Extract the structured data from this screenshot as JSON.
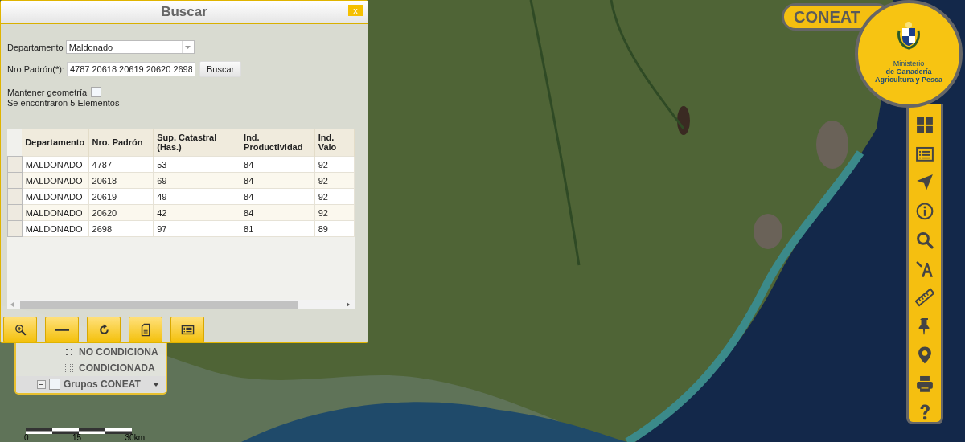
{
  "dialog": {
    "title": "Buscar",
    "close_label": "x",
    "departamento": {
      "label": "Departamento",
      "value": "Maldonado"
    },
    "padron": {
      "label": "Nro Padrón(*):",
      "value": "4787 20618 20619 20620 2698"
    },
    "search_button": "Buscar",
    "keep_geometry": {
      "label": "Mantener geometría",
      "checked": false
    },
    "result_text": "Se encontraron 5 Elementos",
    "table": {
      "columns": [
        "Departamento",
        "Nro. Padrón",
        "Sup. Catastral (Has.)",
        "Ind. Productividad",
        "Ind. Valo"
      ],
      "rows": [
        {
          "cells": [
            "MALDONADO",
            "4787",
            "53",
            "84",
            "92"
          ],
          "selected": false
        },
        {
          "cells": [
            "MALDONADO",
            "20618",
            "69",
            "84",
            "92"
          ],
          "selected": false
        },
        {
          "cells": [
            "MALDONADO",
            "20619",
            "49",
            "84",
            "92"
          ],
          "selected": false
        },
        {
          "cells": [
            "MALDONADO",
            "20620",
            "42",
            "84",
            "92"
          ],
          "selected": false
        },
        {
          "cells": [
            "MALDONADO",
            "2698",
            "97",
            "81",
            "89"
          ],
          "selected": false
        }
      ]
    }
  },
  "layer_panel": {
    "items": [
      {
        "kind": "legend",
        "label": "NO CONDICIONA"
      },
      {
        "kind": "legend",
        "label": "CONDICIONADA"
      },
      {
        "kind": "group",
        "label": "Grupos CONEAT",
        "checked": false,
        "expanded": true
      }
    ]
  },
  "scale": {
    "labels": [
      "0",
      "15",
      "30km"
    ]
  },
  "brand": {
    "name": "CONEAT",
    "ministry_lines": [
      "Ministerio",
      "de Ganadería",
      "Agricultura y Pesca"
    ]
  }
}
